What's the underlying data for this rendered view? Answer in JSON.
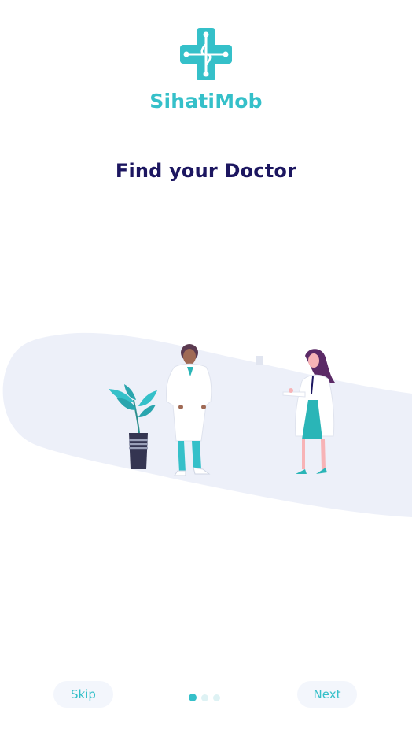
{
  "brand": {
    "name": "SihatiMob",
    "logo_icon": "medical-cross-icon",
    "color": "#35c0c9"
  },
  "slide": {
    "title": "Find your Doctor",
    "illustration": "doctors-illustration",
    "title_color": "#1c1660"
  },
  "pagination": {
    "current": 1,
    "total": 3
  },
  "actions": {
    "skip_label": "Skip",
    "next_label": "Next"
  }
}
